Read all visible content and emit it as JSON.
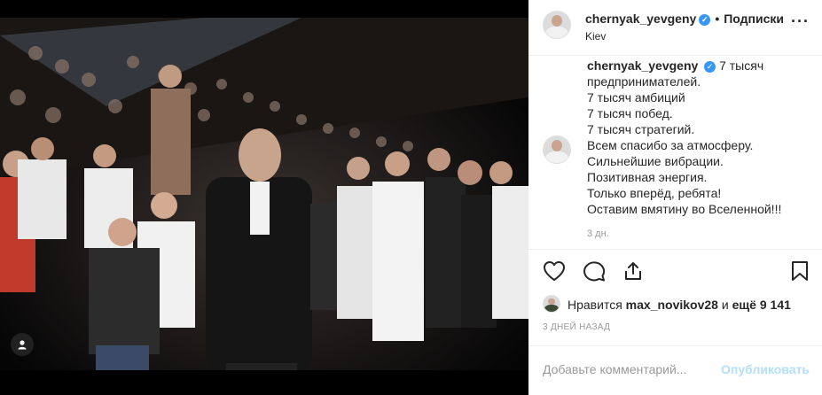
{
  "post": {
    "username": "chernyak_yevgeny",
    "verified_mark": "✓",
    "follow_label": "Подписки",
    "location": "Kiev",
    "more_icon": "···",
    "caption_lines": [
      "7 тысяч",
      "предпринимателей.",
      "7 тысяч амбиций",
      "7 тысяч побед.",
      "7 тысяч стратегий.",
      "Всем спасибо за атмосферу.",
      "Сильнейшие вибрации.",
      "Позитивная энергия.",
      "Только вперёд, ребята!",
      "Оставим вмятину во Вселенной!!!"
    ],
    "caption_time": "3 дн.",
    "likes_prefix": "Нравится",
    "likes_user": "max_novikov28",
    "likes_mid": "и",
    "likes_more": "ещё 9 141",
    "posted_ago": "3 ДНЕЙ НАЗАД",
    "comment_placeholder": "Добавьте комментарий...",
    "publish_label": "Опубликовать"
  },
  "colors": {
    "accent": "#3897f0",
    "publish_disabled": "#b2dffc",
    "muted": "#999999"
  },
  "icons": [
    "user-tag-icon",
    "heart-icon",
    "comment-icon",
    "share-icon",
    "bookmark-icon",
    "verified-icon",
    "more-options-icon"
  ]
}
